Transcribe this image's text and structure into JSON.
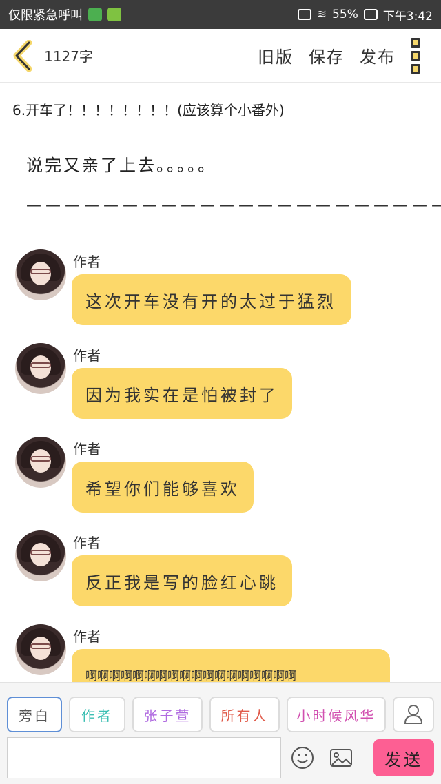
{
  "status_bar": {
    "left_text": "仅限紧急呼叫",
    "battery": "55%",
    "time": "下午3:42"
  },
  "header": {
    "word_count": "1127字",
    "actions": [
      "旧版",
      "保存",
      "发布"
    ]
  },
  "chapter": {
    "title": "6.开车了！！！！！！！！(应该算个小番外)"
  },
  "content": {
    "narration": "说完又亲了上去。。。。。",
    "divider": "——————————————————————"
  },
  "messages": [
    {
      "role": "作者",
      "text": "这次开车没有开的太过于猛烈"
    },
    {
      "role": "作者",
      "text": "因为我实在是怕被封了"
    },
    {
      "role": "作者",
      "text": "希望你们能够喜欢"
    },
    {
      "role": "作者",
      "text": "反正我是写的脸红心跳"
    },
    {
      "role": "作者",
      "text": "啊啊啊啊啊啊啊啊啊啊啊啊啊啊啊啊啊啊"
    }
  ],
  "roles": [
    {
      "label": "旁白",
      "color": "#555555"
    },
    {
      "label": "作者",
      "color": "#3cbfb3"
    },
    {
      "label": "张子萱",
      "color": "#b06be0"
    },
    {
      "label": "所有人",
      "color": "#e05a4a"
    },
    {
      "label": "小时候风华",
      "color": "#d14fb0"
    }
  ],
  "input": {
    "placeholder": "",
    "send_label": "发送"
  }
}
